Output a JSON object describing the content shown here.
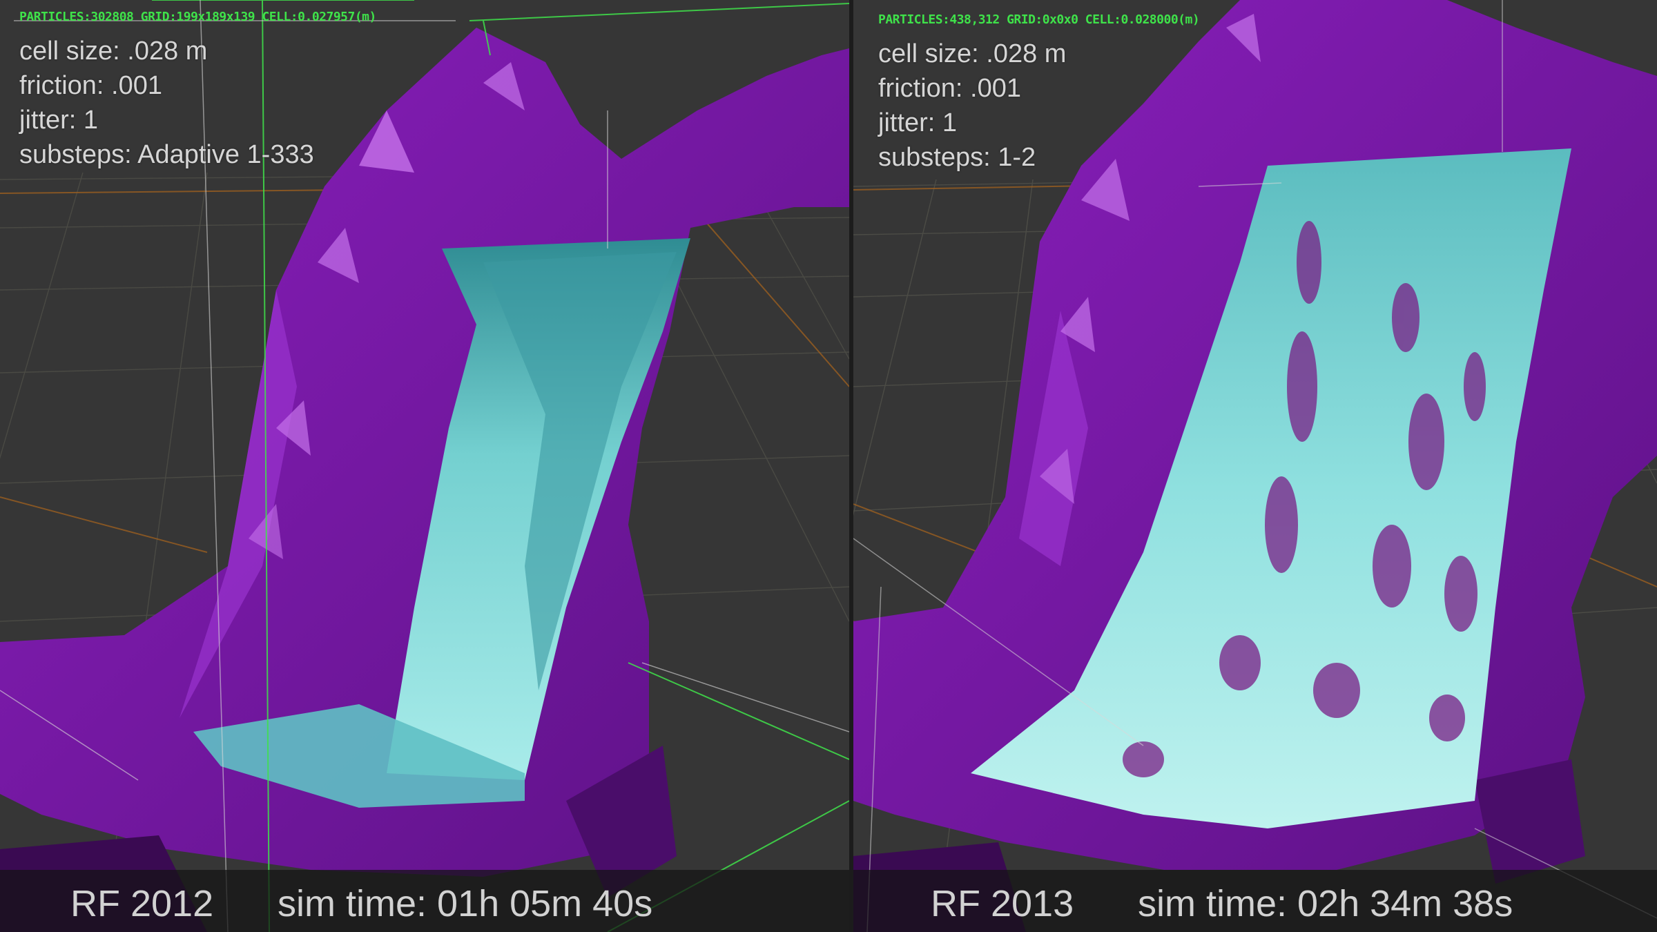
{
  "left": {
    "stats": "PARTICLES:302808 GRID:199x189x139 CELL:0.027957(m)",
    "params": [
      "cell size: .028 m",
      "friction: .001",
      "jitter: 1",
      "substeps: Adaptive 1-333"
    ],
    "version": "RF 2012",
    "sim_time": "sim time: 01h 05m 40s"
  },
  "right": {
    "stats": "PARTICLES:438,312 GRID:0x0x0 CELL:0.028000(m)",
    "params": [
      "cell size: .028 m",
      "friction: .001",
      "jitter: 1",
      "substeps: 1-2"
    ],
    "version": "RF 2013",
    "sim_time": "sim time: 02h 34m 38s"
  },
  "colors": {
    "background": "#363636",
    "rock": "#7a16a6",
    "water": "#6fd1d4",
    "grid_major": "#a8641c",
    "bbox": "#3fe24a",
    "hud_text": "#d6d6d6"
  }
}
